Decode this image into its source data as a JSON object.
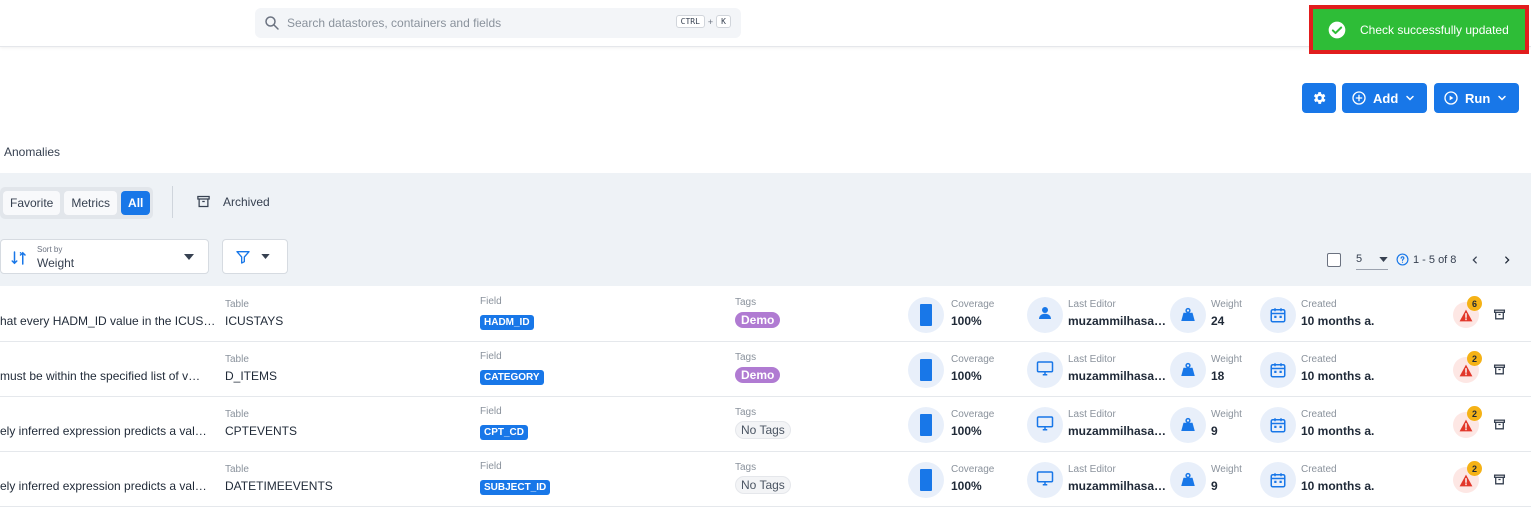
{
  "search": {
    "placeholder": "Search datastores, containers and fields",
    "key1": "CTRL",
    "plus": "+",
    "key2": "K"
  },
  "toast": {
    "message": "Check successfully updated"
  },
  "actions": {
    "add_label": "Add",
    "run_label": "Run"
  },
  "tabs": {
    "anomalies": "Anomalies"
  },
  "filters": {
    "favorite": "Favorite",
    "metrics": "Metrics",
    "all": "All",
    "archived": "Archived"
  },
  "sort": {
    "label": "Sort by",
    "value": "Weight"
  },
  "pager": {
    "per_page": "5",
    "range": "1 - 5 of 8"
  },
  "headers": {
    "table": "Table",
    "field": "Field",
    "tags": "Tags",
    "coverage": "Coverage",
    "editor": "Last Editor",
    "weight": "Weight",
    "created": "Created"
  },
  "rows": [
    {
      "desc": "hat every HADM_ID value in the ICUS…",
      "table": "ICUSTAYS",
      "field": "HADM_ID",
      "tag": "Demo",
      "coverage": "100%",
      "editor": "muzammilhasa…",
      "weight": "24",
      "created": "10 months a.",
      "anomalies": "6",
      "editor_icon": "user-icon"
    },
    {
      "desc": "must be within the specified list of v…",
      "table": "D_ITEMS",
      "field": "CATEGORY",
      "tag": "Demo",
      "coverage": "100%",
      "editor": "muzammilhasa…",
      "weight": "18",
      "created": "10 months a.",
      "anomalies": "2",
      "editor_icon": "monitor-icon"
    },
    {
      "desc": "ely inferred expression predicts a val…",
      "table": "CPTEVENTS",
      "field": "CPT_CD",
      "tag": "No Tags",
      "coverage": "100%",
      "editor": "muzammilhasa…",
      "weight": "9",
      "created": "10 months a.",
      "anomalies": "2",
      "editor_icon": "monitor-icon"
    },
    {
      "desc": "ely inferred expression predicts a val…",
      "table": "DATETIMEEVENTS",
      "field": "SUBJECT_ID",
      "tag": "No Tags",
      "coverage": "100%",
      "editor": "muzammilhasa…",
      "weight": "9",
      "created": "10 months a.",
      "anomalies": "2",
      "editor_icon": "monitor-icon"
    }
  ],
  "colors": {
    "primary": "#1877e8",
    "toast": "#2ebd37",
    "toast_border": "#e11d1d",
    "demo_tag": "#b07bd2",
    "badge": "#f5b216"
  }
}
